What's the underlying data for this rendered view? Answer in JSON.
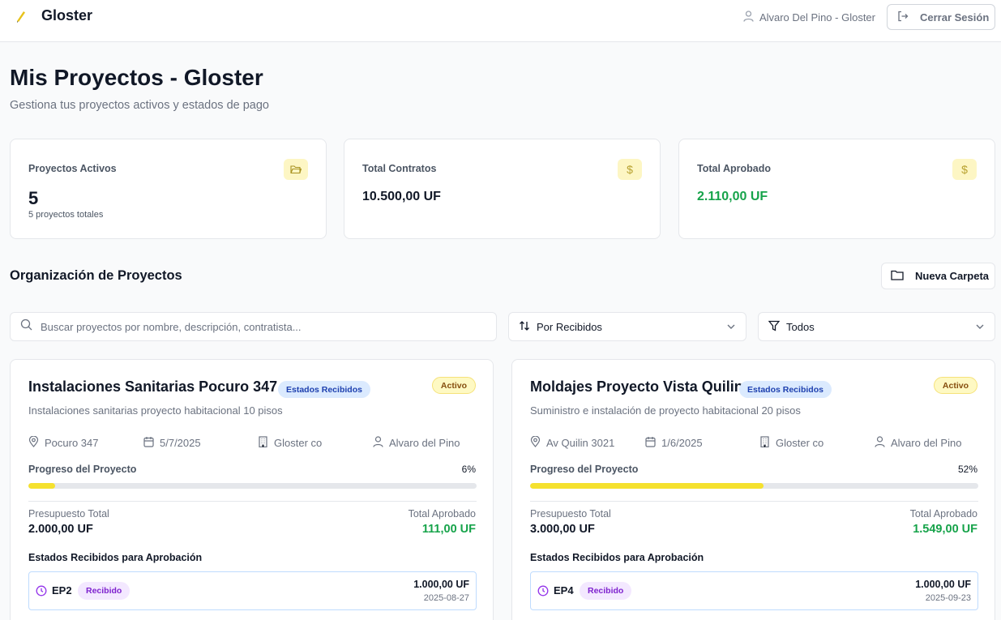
{
  "header": {
    "app_name": "Gloster",
    "user_label": "Alvaro Del Pino - Gloster",
    "logout_label": "Cerrar Sesión"
  },
  "page": {
    "title": "Mis Proyectos - Gloster",
    "subtitle": "Gestiona tus proyectos activos y estados de pago"
  },
  "stats": [
    {
      "label": "Proyectos Activos",
      "value": "5",
      "sub": "5 proyectos totales",
      "icon": "folder-open-icon"
    },
    {
      "label": "Total Contratos",
      "value": "10.500,00 UF",
      "icon": "dollar-icon"
    },
    {
      "label": "Total Aprobado",
      "value": "2.110,00 UF",
      "icon": "dollar-icon"
    }
  ],
  "section": {
    "title": "Organización de Proyectos",
    "new_folder_label": "Nueva Carpeta"
  },
  "filters": {
    "search_placeholder": "Buscar proyectos por nombre, descripción, contratista...",
    "sort_value": "Por Recibidos",
    "filter_value": "Todos"
  },
  "projects": [
    {
      "title": "Instalaciones Sanitarias Pocuro 347",
      "badge": "Estados Recibidos",
      "status": "Activo",
      "description": "Instalaciones sanitarias proyecto habitacional 10 pisos",
      "location": "Pocuro 347",
      "date": "5/7/2025",
      "company": "Gloster co",
      "person": "Alvaro del Pino",
      "progress_label": "Progreso del Proyecto",
      "progress_text": "6%",
      "progress_fraction": 0.06,
      "budget_label": "Presupuesto Total",
      "budget_value": "2.000,00 UF",
      "approved_label": "Total Aprobado",
      "approved_value": "111,00 UF",
      "received_title": "Estados Recibidos para Aprobación",
      "ep": {
        "code": "EP2",
        "badge": "Recibido",
        "amount": "1.000,00 UF",
        "date": "2025-08-27"
      }
    },
    {
      "title": "Moldajes Proyecto Vista Quilin",
      "badge": "Estados Recibidos",
      "status": "Activo",
      "description": "Suministro e instalación de proyecto habitacional 20 pisos",
      "location": "Av Quilin 3021",
      "date": "1/6/2025",
      "company": "Gloster co",
      "person": "Alvaro del Pino",
      "progress_label": "Progreso del Proyecto",
      "progress_text": "52%",
      "progress_fraction": 0.52,
      "budget_label": "Presupuesto Total",
      "budget_value": "3.000,00 UF",
      "approved_label": "Total Aprobado",
      "approved_value": "1.549,00 UF",
      "received_title": "Estados Recibidos para Aprobación",
      "ep": {
        "code": "EP4",
        "badge": "Recibido",
        "amount": "1.000,00 UF",
        "date": "2025-09-23"
      }
    }
  ],
  "colors": {
    "accent_yellow": "#f5e12e",
    "approved_green": "#16a34a",
    "badge_blue": "#dbeafe",
    "badge_purple": "#f3e8ff"
  }
}
